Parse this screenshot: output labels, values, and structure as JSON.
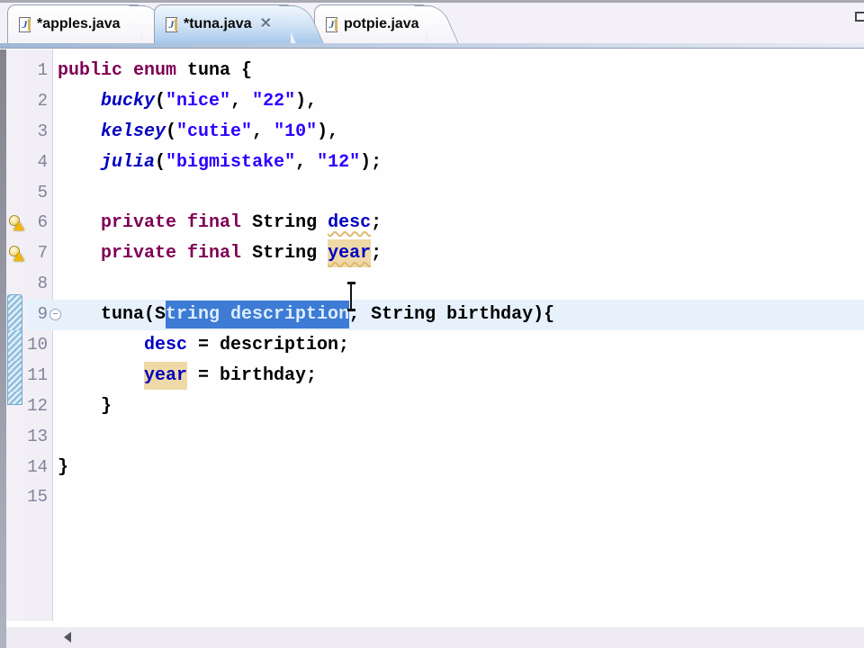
{
  "tabs": [
    {
      "label": "*apples.java",
      "icon": "java-file-icon",
      "active": false
    },
    {
      "label": "*tuna.java",
      "icon": "java-file-icon",
      "active": true
    },
    {
      "label": "potpie.java",
      "icon": "java-file-icon",
      "active": false
    }
  ],
  "icons": {
    "java_file_glyph": "J",
    "close_glyph": "✕",
    "fold_collapse_glyph": "−"
  },
  "colors": {
    "keyword": "#7F0055",
    "string": "#2A00FF",
    "field": "#0000C0",
    "selection_bg": "#3D7BD4",
    "occurrence_bg": "#EFD9A7",
    "current_line_bg": "#E7F1FC",
    "active_tab_bg": "#A6C8EB",
    "range_indicator": "#8FBEDC"
  },
  "segment_styles": {
    "p": "plain",
    "k": "keyword",
    "s": "string-literal",
    "e": "enum-constant-italic",
    "f": "field-reference",
    "fw": "field-with-warning-squiggle",
    "fo": "field-occurrence-highlight-with-squiggle",
    "fh": "field-occurrence-highlight",
    "sel": "selected-text"
  },
  "editor": {
    "current_line": 9,
    "warning_lines": [
      6,
      7
    ],
    "fold_line": 9,
    "range_lines": [
      9,
      10,
      11,
      12
    ],
    "selection_text": "tring description",
    "lines": [
      {
        "num": 1,
        "segments": [
          {
            "t": "public",
            "s": "k"
          },
          {
            "t": " ",
            "s": "p"
          },
          {
            "t": "enum",
            "s": "k"
          },
          {
            "t": " tuna {",
            "s": "p"
          }
        ]
      },
      {
        "num": 2,
        "segments": [
          {
            "t": "    ",
            "s": "p"
          },
          {
            "t": "bucky",
            "s": "e"
          },
          {
            "t": "(",
            "s": "p"
          },
          {
            "t": "\"nice\"",
            "s": "s"
          },
          {
            "t": ", ",
            "s": "p"
          },
          {
            "t": "\"22\"",
            "s": "s"
          },
          {
            "t": "),",
            "s": "p"
          }
        ]
      },
      {
        "num": 3,
        "segments": [
          {
            "t": "    ",
            "s": "p"
          },
          {
            "t": "kelsey",
            "s": "e"
          },
          {
            "t": "(",
            "s": "p"
          },
          {
            "t": "\"cutie\"",
            "s": "s"
          },
          {
            "t": ", ",
            "s": "p"
          },
          {
            "t": "\"10\"",
            "s": "s"
          },
          {
            "t": "),",
            "s": "p"
          }
        ]
      },
      {
        "num": 4,
        "segments": [
          {
            "t": "    ",
            "s": "p"
          },
          {
            "t": "julia",
            "s": "e"
          },
          {
            "t": "(",
            "s": "p"
          },
          {
            "t": "\"bigmistake\"",
            "s": "s"
          },
          {
            "t": ", ",
            "s": "p"
          },
          {
            "t": "\"12\"",
            "s": "s"
          },
          {
            "t": ");",
            "s": "p"
          }
        ]
      },
      {
        "num": 5,
        "segments": []
      },
      {
        "num": 6,
        "segments": [
          {
            "t": "    ",
            "s": "p"
          },
          {
            "t": "private",
            "s": "k"
          },
          {
            "t": " ",
            "s": "p"
          },
          {
            "t": "final",
            "s": "k"
          },
          {
            "t": " String ",
            "s": "p"
          },
          {
            "t": "desc",
            "s": "fw"
          },
          {
            "t": ";",
            "s": "p"
          }
        ]
      },
      {
        "num": 7,
        "segments": [
          {
            "t": "    ",
            "s": "p"
          },
          {
            "t": "private",
            "s": "k"
          },
          {
            "t": " ",
            "s": "p"
          },
          {
            "t": "final",
            "s": "k"
          },
          {
            "t": " String ",
            "s": "p"
          },
          {
            "t": "year",
            "s": "fo"
          },
          {
            "t": ";",
            "s": "p"
          }
        ]
      },
      {
        "num": 8,
        "segments": []
      },
      {
        "num": 9,
        "segments": [
          {
            "t": "    tuna(S",
            "s": "p"
          },
          {
            "t": "tring description",
            "s": "sel"
          },
          {
            "t": ", String birthday){",
            "s": "p"
          }
        ]
      },
      {
        "num": 10,
        "segments": [
          {
            "t": "        ",
            "s": "p"
          },
          {
            "t": "desc",
            "s": "f"
          },
          {
            "t": " = description;",
            "s": "p"
          }
        ]
      },
      {
        "num": 11,
        "segments": [
          {
            "t": "        ",
            "s": "p"
          },
          {
            "t": "year",
            "s": "fh"
          },
          {
            "t": " = birthday;",
            "s": "p"
          }
        ]
      },
      {
        "num": 12,
        "segments": [
          {
            "t": "    }",
            "s": "p"
          }
        ]
      },
      {
        "num": 13,
        "segments": []
      },
      {
        "num": 14,
        "segments": [
          {
            "t": "}",
            "s": "p"
          }
        ]
      },
      {
        "num": 15,
        "segments": []
      }
    ]
  }
}
